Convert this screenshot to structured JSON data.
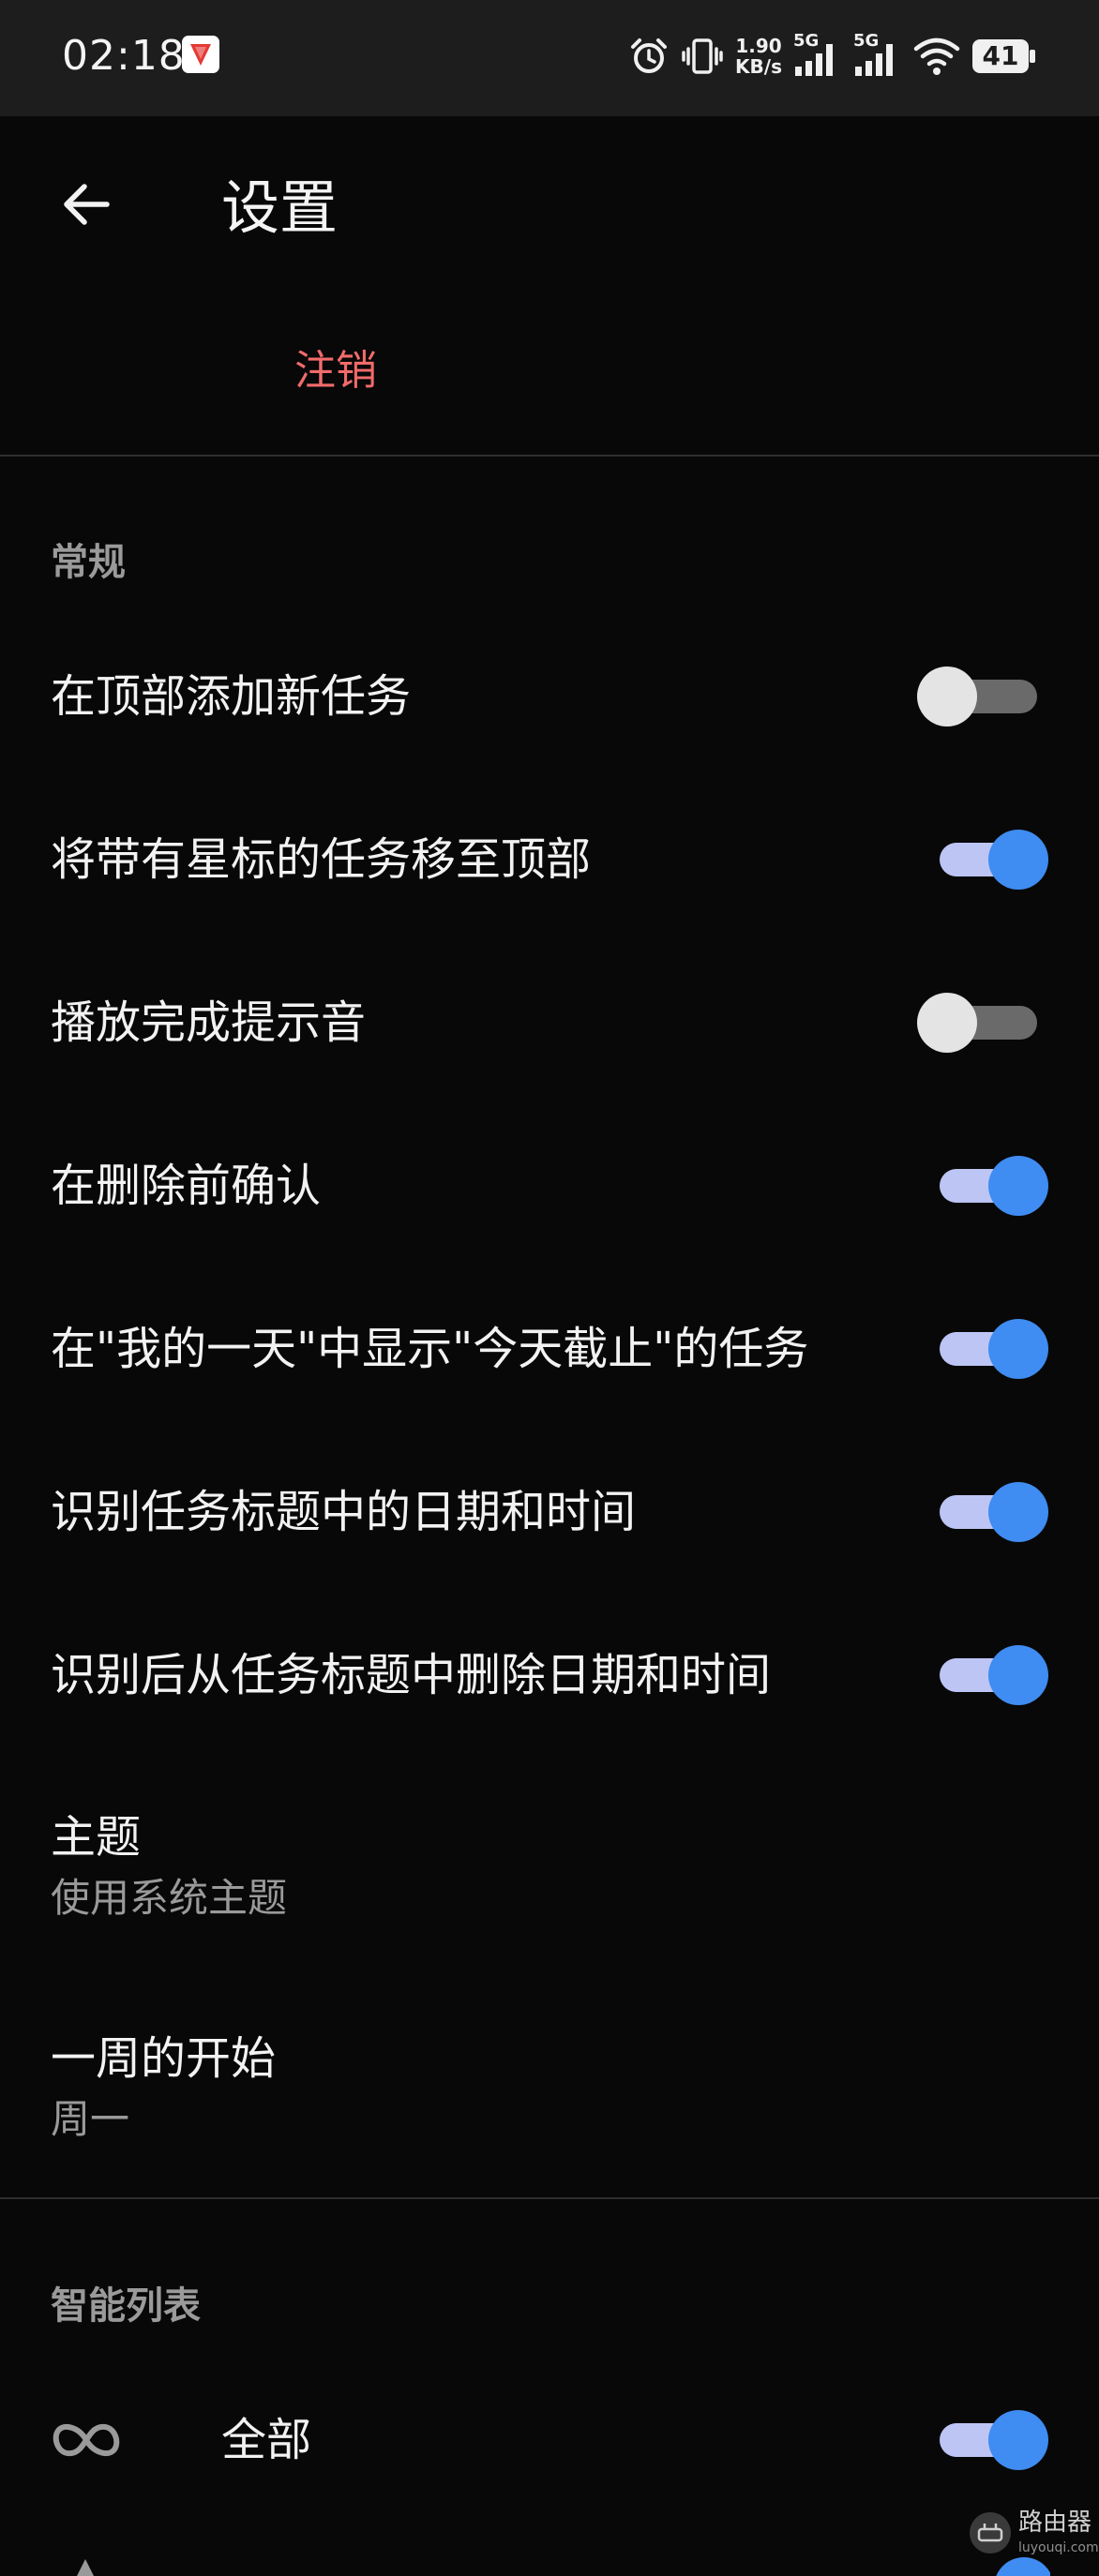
{
  "status_bar": {
    "time": "02:18",
    "network_speed_value": "1.90",
    "network_speed_unit": "KB/s",
    "sim1_label": "5G",
    "sim2_label": "5G",
    "battery_level": "41"
  },
  "header": {
    "title": "设置",
    "logout_label": "注销"
  },
  "general": {
    "header": "常规",
    "toggles": [
      {
        "label": "在顶部添加新任务",
        "on": false
      },
      {
        "label": "将带有星标的任务移至顶部",
        "on": true
      },
      {
        "label": "播放完成提示音",
        "on": false
      },
      {
        "label": "在删除前确认",
        "on": true
      },
      {
        "label": "在\"我的一天\"中显示\"今天截止\"的任务",
        "on": true
      },
      {
        "label": "识别任务标题中的日期和时间",
        "on": true
      },
      {
        "label": "识别后从任务标题中删除日期和时间",
        "on": true
      }
    ],
    "theme": {
      "title": "主题",
      "value": "使用系统主题"
    },
    "week_start": {
      "title": "一周的开始",
      "value": "周一"
    }
  },
  "smart_lists": {
    "header": "智能列表",
    "items": [
      {
        "label": "全部",
        "icon": "infinity-icon",
        "on": true
      }
    ]
  },
  "watermark": {
    "title": "路由器",
    "subtitle": "luyouqi.com"
  },
  "colors": {
    "accent": "#3f8cf2",
    "accent_track": "#bcc5f4",
    "destructive": "#f26b6b",
    "background": "#080808"
  }
}
